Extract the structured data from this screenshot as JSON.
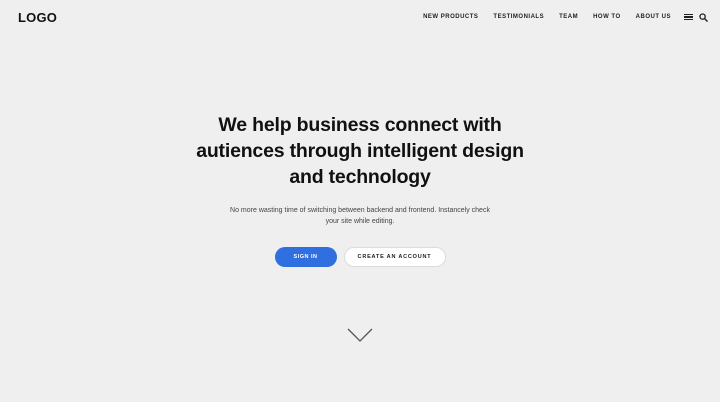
{
  "header": {
    "logo": "LOGO",
    "nav": [
      {
        "label": "NEW PRODUCTS"
      },
      {
        "label": "TESTIMONIALS"
      },
      {
        "label": "TEAM"
      },
      {
        "label": "HOW TO"
      },
      {
        "label": "ABOUT US"
      }
    ],
    "icons": {
      "menu": "hamburger-menu-icon",
      "search": "search-icon"
    }
  },
  "hero": {
    "headline": "We help business connect with autiences through intelligent design and technology",
    "subtext": "No more wasting time of switching between backend and frontend. Instancely check your site while editing.",
    "primary_button": "SIGN IN",
    "secondary_button": "CREATE AN ACCOUNT",
    "scroll_icon": "chevron-down-icon"
  },
  "colors": {
    "background": "#efefef",
    "primary": "#2f6fe0",
    "text": "#111111"
  }
}
